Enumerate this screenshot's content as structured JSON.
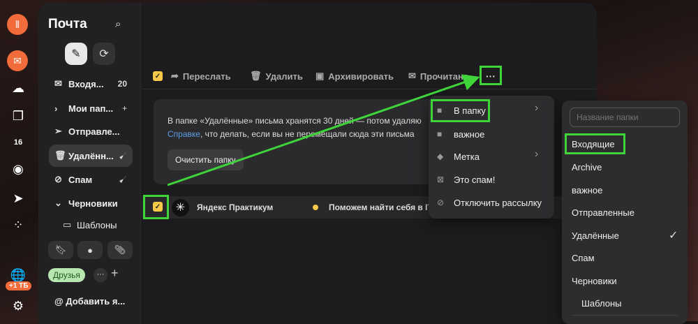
{
  "app": {
    "title": "Почта",
    "storage_badge": "+1 ТБ"
  },
  "sidebar": {
    "folders": [
      {
        "label": "Входя...",
        "count": "20",
        "icon": "envelope-icon"
      },
      {
        "label": "Мои пап...",
        "tail": "+",
        "icon": "chevron-right-icon"
      },
      {
        "label": "Отправле...",
        "icon": "send-icon"
      },
      {
        "label": "Удалённ...",
        "tail": "🧹",
        "icon": "trash-icon"
      },
      {
        "label": "Спам",
        "tail": "🧹",
        "icon": "spam-icon"
      },
      {
        "label": "Черновики",
        "icon": "chevron-down-icon"
      },
      {
        "label": "Шаблоны",
        "icon": "template-icon"
      }
    ],
    "label_chip": "Друзья",
    "add_mailbox": "Добавить я..."
  },
  "toolbar": {
    "forward": "Переслать",
    "delete": "Удалить",
    "archive": "Архивировать",
    "read": "Прочитано",
    "more": "···"
  },
  "notice": {
    "text1": "В папке «Удалённые» письма хранятся 30 дней — потом удаляю",
    "link": "Справке",
    "text2": ", что делать, если вы не перемещали сюда эти письма",
    "button": "Очистить папку"
  },
  "email": {
    "sender": "Яндекс Практикум",
    "subject": "Поможем найти себя в IT"
  },
  "more_menu": [
    "В папку",
    "важное",
    "Метка",
    "Это спам!",
    "Отключить рассылку"
  ],
  "folder_menu": {
    "placeholder": "Название папки",
    "items": [
      "Входящие",
      "Archive",
      "важное",
      "Отправленные",
      "Удалённые",
      "Спам",
      "Черновики",
      "Шаблоны"
    ],
    "checked": "Удалённые"
  },
  "colors": {
    "highlight": "#3fd43a",
    "accent": "#f26b3a",
    "checkbox": "#f7c948"
  }
}
